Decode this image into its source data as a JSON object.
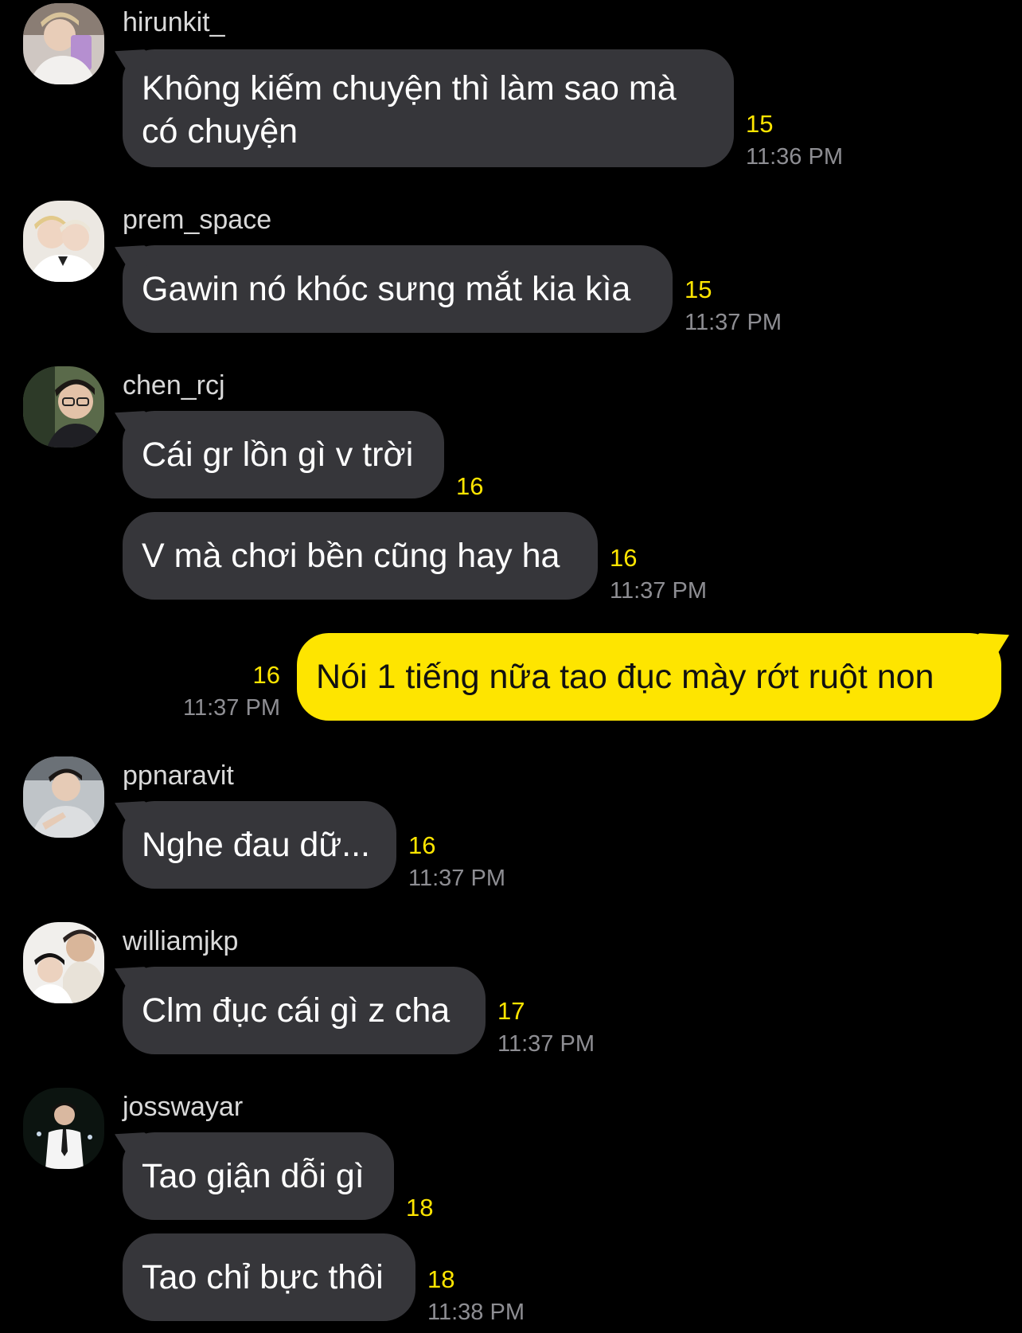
{
  "colors": {
    "background": "#000000",
    "incoming_bubble": "#36363a",
    "outgoing_bubble": "#fee500",
    "unread_count": "#fee500",
    "timestamp": "#8e8e93"
  },
  "messages": [
    {
      "sender": "hirunkit_",
      "avatar_icon": "user-avatar-photo",
      "text": "Không kiếm chuyện thì làm sao mà có chuyện",
      "unread": "15",
      "time": "11:36 PM"
    },
    {
      "sender": "prem_space",
      "avatar_icon": "user-avatar-photo",
      "text": "Gawin nó khóc sưng mắt kia kìa",
      "unread": "15",
      "time": "11:37 PM"
    },
    {
      "sender": "chen_rcj",
      "avatar_icon": "user-avatar-photo",
      "text": "Cái gr lồn gì v trời",
      "unread": "16",
      "time": ""
    },
    {
      "sender": "",
      "text": "V mà chơi bền cũng hay ha",
      "unread": "16",
      "time": "11:37 PM"
    },
    {
      "sender": "me",
      "text": "Nói 1 tiếng nữa tao đục mày rớt ruột non",
      "unread": "16",
      "time": "11:37 PM"
    },
    {
      "sender": "ppnaravit",
      "avatar_icon": "user-avatar-photo",
      "text": "Nghe đau dữ...",
      "unread": "16",
      "time": "11:37 PM"
    },
    {
      "sender": "williamjkp",
      "avatar_icon": "user-avatar-photo",
      "text": "Clm đục cái gì z cha",
      "unread": "17",
      "time": "11:37 PM"
    },
    {
      "sender": "josswayar",
      "avatar_icon": "user-avatar-photo",
      "text": "Tao giận dỗi gì",
      "unread": "18",
      "time": ""
    },
    {
      "sender": "",
      "text": "Tao chỉ bực thôi",
      "unread": "18",
      "time": "11:38 PM"
    }
  ]
}
